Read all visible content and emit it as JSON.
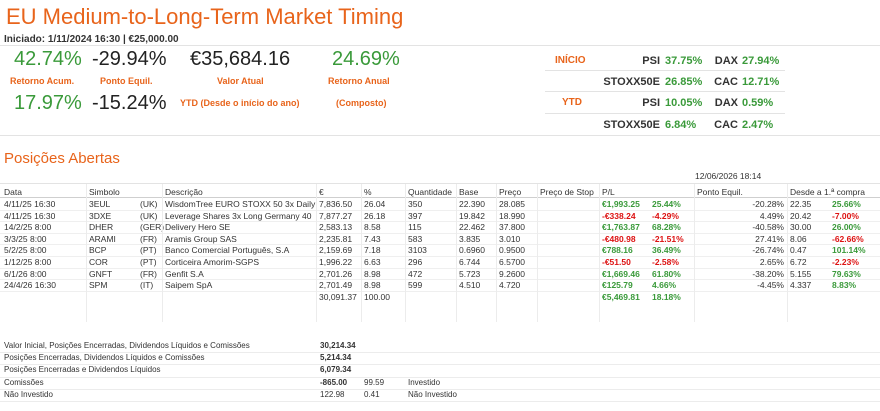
{
  "header": {
    "title": "EU Medium-to-Long-Term Market Timing",
    "subtitle": "Iniciado: 1/11/2024 16:30 | €25,000.00"
  },
  "stats": {
    "retorno_acum": "42.74%",
    "retorno_acum_label": "Retorno Acum.",
    "ponto_equil": "-29.94%",
    "ponto_equil_label": "Ponto Equil.",
    "valor_atual": "€35,684.16",
    "valor_atual_label": "Valor Atual",
    "retorno_anual": "24.69%",
    "retorno_anual_label": "Retorno Anual",
    "ytd_value": "17.97%",
    "ytd_value2": "-15.24%",
    "ytd_label": "YTD (Desde o início do ano)",
    "composto_label": "(Composto)"
  },
  "indices": {
    "inicio_label": "INÍCIO",
    "ytd_label": "YTD",
    "inicio": [
      {
        "name": "PSI",
        "value": "37.75%",
        "name2": "DAX",
        "value2": "27.94%"
      },
      {
        "name": "STOXX50E",
        "value": "26.85%",
        "name2": "CAC",
        "value2": "12.71%"
      }
    ],
    "ytd": [
      {
        "name": "PSI",
        "value": "10.05%",
        "name2": "DAX",
        "value2": "0.59%"
      },
      {
        "name": "STOXX50E",
        "value": "6.84%",
        "name2": "CAC",
        "value2": "2.47%"
      }
    ]
  },
  "positions": {
    "section_title": "Posições Abertas",
    "timestamp": "12/06/2026 18:14",
    "columns": {
      "data": "Data",
      "simbolo": "Simbolo",
      "descricao": "Descrição",
      "eur": "€",
      "pct": "%",
      "quantidade": "Quantidade",
      "base": "Base",
      "preco": "Preço",
      "stop": "Preço de Stop",
      "pl": "P/L",
      "equil": "Ponto Equil.",
      "desde": "Desde a 1.ª compra"
    },
    "rows": [
      {
        "data": "4/11/25 16:30",
        "simbolo": "3EUL",
        "mercado": "(UK)",
        "descricao": "WisdomTree EURO STOXX 50 3x Daily",
        "eur": "7,836.50",
        "pct": "26.04",
        "qtd": "350",
        "base": "22.390",
        "preco": "28.085",
        "pl": "€1,993.25",
        "pl_pct": "25.44%",
        "pl_neg": false,
        "equil": "-20.28%",
        "desde": "22.35",
        "desde_pct": "25.66%",
        "desde_neg": false
      },
      {
        "data": "4/11/25 16:30",
        "simbolo": "3DXE",
        "mercado": "(UK)",
        "descricao": "Leverage Shares 3x Long Germany 40",
        "eur": "7,877.27",
        "pct": "26.18",
        "qtd": "397",
        "base": "19.842",
        "preco": "18.990",
        "pl": "-€338.24",
        "pl_pct": "-4.29%",
        "pl_neg": true,
        "equil": "4.49%",
        "desde": "20.42",
        "desde_pct": "-7.00%",
        "desde_neg": true
      },
      {
        "data": "14/2/25 8:00",
        "simbolo": "DHER",
        "mercado": "(GER)",
        "descricao": "Delivery Hero SE",
        "eur": "2,583.13",
        "pct": "8.58",
        "qtd": "115",
        "base": "22.462",
        "preco": "37.800",
        "pl": "€1,763.87",
        "pl_pct": "68.28%",
        "pl_neg": false,
        "equil": "-40.58%",
        "desde": "30.00",
        "desde_pct": "26.00%",
        "desde_neg": false
      },
      {
        "data": "3/3/25 8:00",
        "simbolo": "ARAMI",
        "mercado": "(FR)",
        "descricao": "Aramis Group SAS",
        "eur": "2,235.81",
        "pct": "7.43",
        "qtd": "583",
        "base": "3.835",
        "preco": "3.010",
        "pl": "-€480.98",
        "pl_pct": "-21.51%",
        "pl_neg": true,
        "equil": "27.41%",
        "desde": "8.06",
        "desde_pct": "-62.66%",
        "desde_neg": true
      },
      {
        "data": "5/2/25 8:00",
        "simbolo": "BCP",
        "mercado": "(PT)",
        "descricao": "Banco Comercial Português, S.A",
        "eur": "2,159.69",
        "pct": "7.18",
        "qtd": "3103",
        "base": "0.6960",
        "preco": "0.9500",
        "pl": "€788.16",
        "pl_pct": "36.49%",
        "pl_neg": false,
        "equil": "-26.74%",
        "desde": "0.47",
        "desde_pct": "101.14%",
        "desde_neg": false
      },
      {
        "data": "1/12/25 8:00",
        "simbolo": "COR",
        "mercado": "(PT)",
        "descricao": "Corticeira Amorim-SGPS",
        "eur": "1,996.22",
        "pct": "6.63",
        "qtd": "296",
        "base": "6.744",
        "preco": "6.5700",
        "pl": "-€51.50",
        "pl_pct": "-2.58%",
        "pl_neg": true,
        "equil": "2.65%",
        "desde": "6.72",
        "desde_pct": "-2.23%",
        "desde_neg": true
      },
      {
        "data": "6/1/26 8:00",
        "simbolo": "GNFT",
        "mercado": "(FR)",
        "descricao": "Genfit S.A",
        "eur": "2,701.26",
        "pct": "8.98",
        "qtd": "472",
        "base": "5.723",
        "preco": "9.2600",
        "pl": "€1,669.46",
        "pl_pct": "61.80%",
        "pl_neg": false,
        "equil": "-38.20%",
        "desde": "5.155",
        "desde_pct": "79.63%",
        "desde_neg": false
      },
      {
        "data": "24/4/26 16:30",
        "simbolo": "SPM",
        "mercado": "(IT)",
        "descricao": "Saipem SpA",
        "eur": "2,701.49",
        "pct": "8.98",
        "qtd": "599",
        "base": "4.510",
        "preco": "4.720",
        "pl": "€125.79",
        "pl_pct": "4.66%",
        "pl_neg": false,
        "equil": "-4.45%",
        "desde": "4.337",
        "desde_pct": "8.83%",
        "desde_neg": false
      }
    ],
    "total": {
      "eur": "30,091.37",
      "pct": "100.00",
      "pl": "€5,469.81",
      "pl_pct": "18.18%"
    }
  },
  "summary": [
    {
      "label": "Valor Inicial, Posições Encerradas, Dividendos Líquidos e Comissões",
      "value": "30,214.34",
      "neg": false,
      "extra1": "",
      "extra2": ""
    },
    {
      "label": "Posições Encerradas, Dividendos Líquidos e Comissões",
      "value": "5,214.34",
      "neg": false,
      "extra1": "",
      "extra2": ""
    },
    {
      "label": "Posições Encerradas e Dividendos Líquidos",
      "value": "6,079.34",
      "neg": false,
      "extra1": "",
      "extra2": ""
    },
    {
      "label": "Comissões",
      "value": "-865.00",
      "neg": true,
      "extra1": "99.59",
      "extra2": "Investido"
    },
    {
      "label": "Não Investido",
      "value": "122.98",
      "neg": false,
      "plain": true,
      "extra1": "0.41",
      "extra2": "Não Investido"
    }
  ]
}
